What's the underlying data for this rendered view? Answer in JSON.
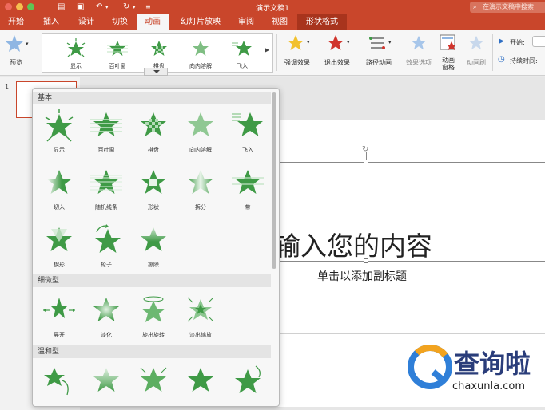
{
  "window": {
    "title": "演示文稿1",
    "search_placeholder": "在演示文稿中搜索"
  },
  "tabs": [
    {
      "label": "开始"
    },
    {
      "label": "插入"
    },
    {
      "label": "设计"
    },
    {
      "label": "切换"
    },
    {
      "label": "动画",
      "active": true
    },
    {
      "label": "幻灯片放映"
    },
    {
      "label": "审阅"
    },
    {
      "label": "视图"
    },
    {
      "label": "形状格式",
      "contextual": true
    }
  ],
  "ribbon": {
    "preview_label": "预览",
    "gallery": [
      "显示",
      "百叶窗",
      "棋盘",
      "向内溶解",
      "飞入"
    ],
    "emphasis_label": "强调效果",
    "exit_label": "退出效果",
    "path_label": "路径动画",
    "effect_options_label": "效果选项",
    "animation_pane_label": "动画\n窗格",
    "animation_pane_l1": "动画",
    "animation_pane_l2": "窗格",
    "reorder_label": "动画刷",
    "start_label": "开始:",
    "duration_label": "持续时间:"
  },
  "slides": {
    "current_number": "1"
  },
  "slide": {
    "title_placeholder": "输入您的内容",
    "subtitle_placeholder": "单击以添加副标题"
  },
  "popup": {
    "sections": [
      {
        "title": "基本",
        "items": [
          "显示",
          "百叶窗",
          "棋盘",
          "向内溶解",
          "飞入",
          "切入",
          "随机线条",
          "形状",
          "拆分",
          "带",
          "楔形",
          "轮子",
          "擦除"
        ]
      },
      {
        "title": "细微型",
        "items": [
          "展开",
          "淡化",
          "旋出旋转",
          "淡出缩放"
        ]
      },
      {
        "title": "温和型",
        "items": [
          "",
          "",
          "",
          "",
          ""
        ]
      }
    ]
  },
  "watermark": {
    "brand": "查询啦",
    "url": "chaxunla.com"
  },
  "colors": {
    "accent": "#c9462b",
    "star_green": "#3f9a46",
    "star_gold": "#f2c12e",
    "star_red": "#d0342c",
    "star_blue": "#8fb6e3",
    "brand_blue": "#2a3d7a"
  }
}
